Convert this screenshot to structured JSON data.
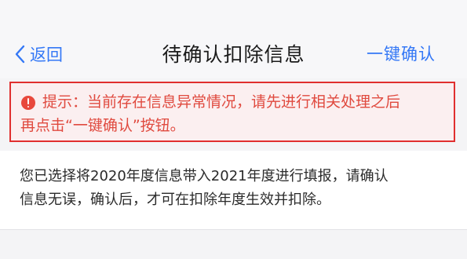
{
  "nav": {
    "back_label": "返回",
    "title": "待确认扣除信息",
    "confirm_label": "一键确认"
  },
  "alert": {
    "line1": "提示：当前存在信息异常情况，请先进行相关处理之后",
    "line2": "再点击“一键确认”按钮。"
  },
  "info": {
    "line1": "您已选择将2020年度信息带入2021年度进行填报，请确认",
    "line2": "信息无误，确认后，才可在扣除年度生效并扣除。"
  },
  "colors": {
    "accent": "#3478f6",
    "alert_border": "#e02f2f",
    "alert_text": "#e04a3f",
    "alert_bg": "#fbeff0"
  }
}
